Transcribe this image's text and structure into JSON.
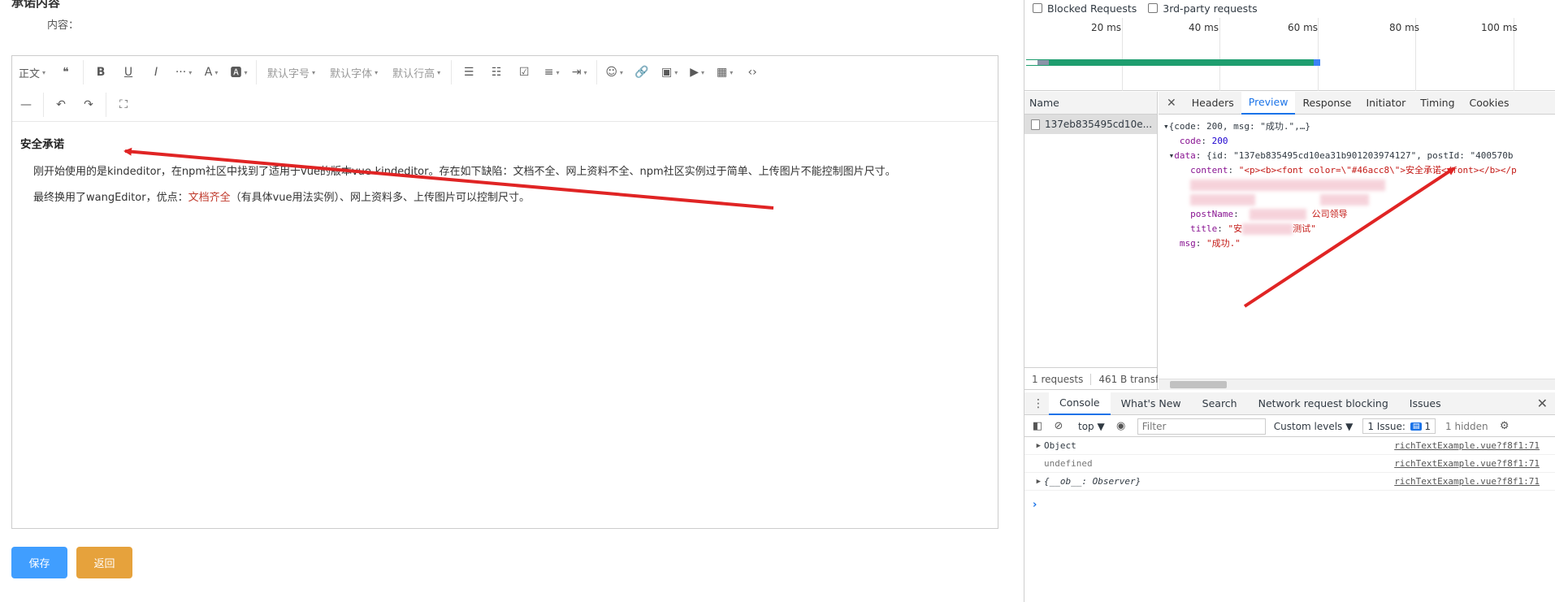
{
  "form": {
    "title": "承诺内容",
    "content_label": "内容："
  },
  "toolbar": {
    "row1": [
      {
        "name": "paragraph-select",
        "label": "正文",
        "caret": true
      },
      {
        "name": "quote-icon",
        "glyph": "❝"
      },
      {
        "sep": true
      },
      {
        "name": "bold-icon",
        "glyph": "B"
      },
      {
        "name": "underline-icon",
        "glyph": "U"
      },
      {
        "name": "italic-icon",
        "glyph": "I"
      },
      {
        "name": "more-icon",
        "glyph": "···",
        "caret": true
      },
      {
        "name": "font-color-icon",
        "glyph": "A",
        "caret": true
      },
      {
        "name": "bg-color-icon",
        "glyph": "🅰",
        "caret": true
      },
      {
        "sep": true
      },
      {
        "name": "font-size-select",
        "label": "默认字号",
        "caret": true,
        "text": true
      },
      {
        "name": "font-family-select",
        "label": "默认字体",
        "caret": true,
        "text": true
      },
      {
        "name": "line-height-select",
        "label": "默认行高",
        "caret": true,
        "text": true
      },
      {
        "sep": true
      },
      {
        "name": "bullet-list-icon",
        "glyph": "☰"
      },
      {
        "name": "numbered-list-icon",
        "glyph": "☷"
      },
      {
        "name": "todo-icon",
        "glyph": "☑"
      },
      {
        "name": "justify-icon",
        "glyph": "≡",
        "caret": true
      },
      {
        "name": "indent-icon",
        "glyph": "⇥",
        "caret": true
      },
      {
        "sep": true
      },
      {
        "name": "emoji-icon",
        "glyph": "☺",
        "caret": true
      },
      {
        "name": "link-icon",
        "glyph": "🔗"
      },
      {
        "name": "image-icon",
        "glyph": "▣",
        "caret": true
      },
      {
        "name": "video-icon",
        "glyph": "▶",
        "caret": true
      },
      {
        "name": "table-icon",
        "glyph": "▦",
        "caret": true
      },
      {
        "name": "code-icon",
        "glyph": "‹›"
      }
    ],
    "row2": [
      {
        "name": "divider-icon",
        "glyph": "—"
      },
      {
        "sep": true
      },
      {
        "name": "undo-icon",
        "glyph": "↶"
      },
      {
        "name": "redo-icon",
        "glyph": "↷"
      },
      {
        "sep": true
      },
      {
        "name": "fullscreen-icon",
        "glyph": "⛶"
      }
    ]
  },
  "editor": {
    "heading": "安全承诺",
    "p1": "刚开始使用的是kindeditor，在npm社区中找到了适用于vue的版本vue-kindeditor。存在如下缺陷：文档不全、网上资料不全、npm社区实例过于简单、上传图片不能控制图片尺寸。",
    "p2_a": "最终换用了wangEditor，优点：",
    "p2_red": "文档齐全",
    "p2_b": "（有具体vue用法实例）、网上资料多、上传图片可以控制尺寸。"
  },
  "buttons": {
    "save": "保存",
    "back": "返回"
  },
  "devtools": {
    "blocked_requests": "Blocked Requests",
    "third_party": "3rd-party requests",
    "timeline_labels": [
      "20 ms",
      "40 ms",
      "60 ms",
      "80 ms",
      "100 ms"
    ],
    "name_header": "Name",
    "request_name": "137eb835495cd10e...",
    "footer_requests": "1 requests",
    "footer_transfer": "461 B transf",
    "tabs": [
      "Headers",
      "Preview",
      "Response",
      "Initiator",
      "Timing",
      "Cookies"
    ],
    "active_tab": "Preview",
    "json": {
      "l1": "{code: 200, msg: \"成功.\",…}",
      "code_key": "code",
      "code_val": "200",
      "data_key": "data",
      "data_summary": "{id: \"137eb835495cd10ea31b901203974127\", postId: \"400570b",
      "content_key": "content",
      "content_val": "\"<p><b><font color=\\\"#46acc8\\\">安全承诺</font></b></p",
      "postname_key": "postName",
      "postname_val": "公司领导",
      "title_key": "title",
      "title_val_a": "\"安",
      "title_val_b": "测试\"",
      "msg_key": "msg",
      "msg_val": "\"成功.\""
    },
    "console_tabs": [
      "Console",
      "What's New",
      "Search",
      "Network request blocking",
      "Issues"
    ],
    "context": "top",
    "filter_placeholder": "Filter",
    "levels": "Custom levels",
    "issue_label": "1 Issue:",
    "issue_count": "1",
    "hidden": "1 hidden",
    "rows": [
      {
        "text": "Object",
        "expandable": true,
        "src": "richTextExample.vue?f8f1:71"
      },
      {
        "text": "undefined",
        "expandable": false,
        "src": "richTextExample.vue?f8f1:71"
      },
      {
        "text": "{__ob__: Observer}",
        "expandable": true,
        "src": "richTextExample.vue?f8f1:71"
      }
    ]
  },
  "colors": {
    "save_btn": "#409eff",
    "back_btn": "#e6a23c",
    "arrow": "#e02424",
    "tl_green": "#1e9e6f",
    "tl_blue": "#3b82f6"
  }
}
